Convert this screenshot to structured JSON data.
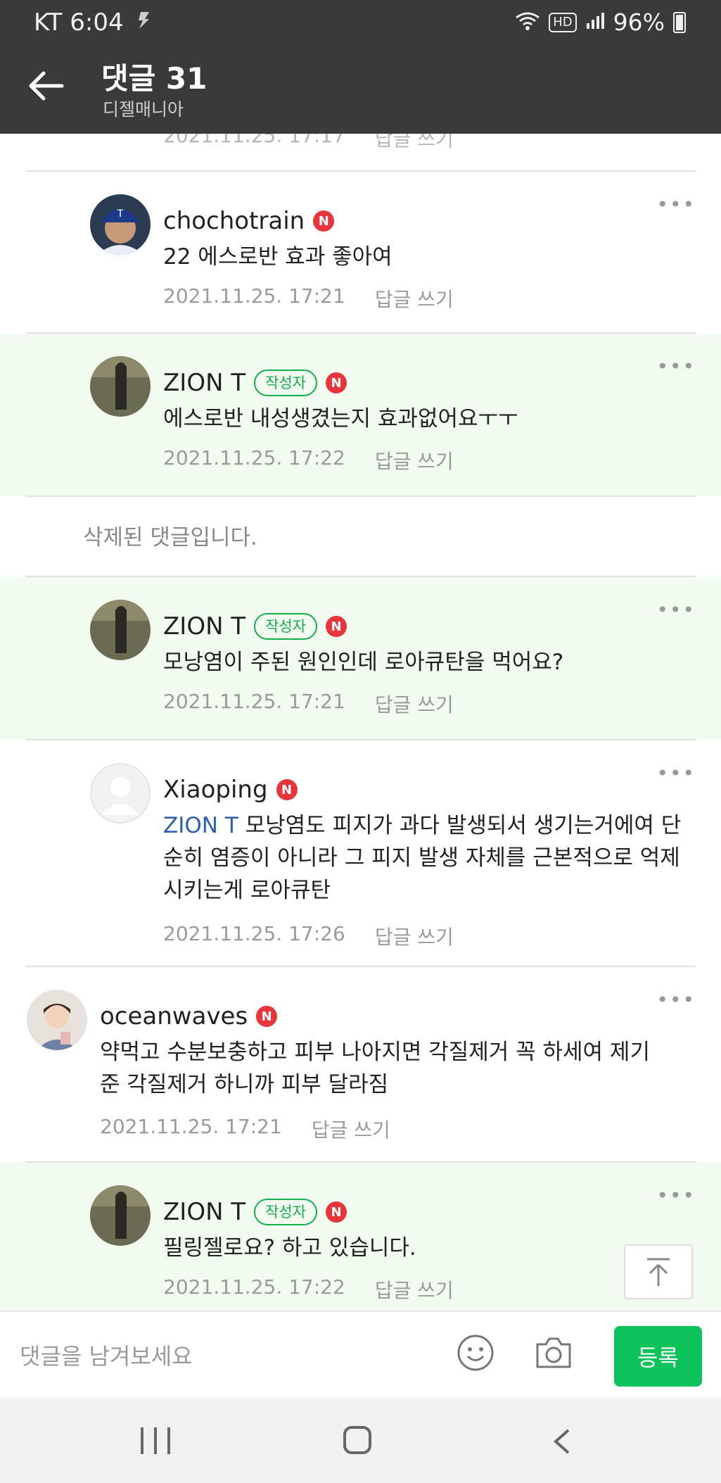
{
  "status": {
    "carrier_time": "KT 6:04",
    "network": "HD",
    "battery": "96%"
  },
  "header": {
    "title": "댓글 31",
    "subtitle": "디젤매니아"
  },
  "reply_label": "답글 쓰기",
  "author_badge": "작성자",
  "n_badge": "N",
  "more_glyph": "•••",
  "comments": [
    {
      "nick": "chochotrain",
      "text": "22 에스로반 효과 좋아여",
      "date": "2021.11.25. 17:21"
    },
    {
      "nick": "ZION T",
      "text": "에스로반 내성생겼는지 효과없어요ㅜㅜ",
      "date": "2021.11.25. 17:22"
    },
    {
      "deleted_text": "삭제된 댓글입니다."
    },
    {
      "nick": "ZION T",
      "text": "모낭염이 주된 원인인데 로아큐탄을 먹어요?",
      "date": "2021.11.25. 17:21"
    },
    {
      "nick": "Xiaoping",
      "mention": "ZION T",
      "text": " 모낭염도 피지가 과다 발생되서 생기는거에여 단순히 염증이 아니라 그 피지 발생 자체를 근본적으로 억제시키는게 로아큐탄",
      "date": "2021.11.25. 17:26"
    },
    {
      "nick": "oceanwaves",
      "text": "약먹고 수분보충하고 피부 나아지면 각질제거 꼭 하세여 제기준 각질제거 하니까 피부 달라짐",
      "date": "2021.11.25. 17:21"
    },
    {
      "nick": "ZION T",
      "text": "필링젤로요? 하고 있습니다.",
      "date": "2021.11.25. 17:22"
    }
  ],
  "input": {
    "placeholder": "댓글을 남겨보세요",
    "submit_label": "등록"
  },
  "colors": {
    "author_bg": "#f2fbf0",
    "accent_green": "#0bc35a",
    "n_badge_red": "#e8343b",
    "mention_blue": "#2f5fb3"
  }
}
